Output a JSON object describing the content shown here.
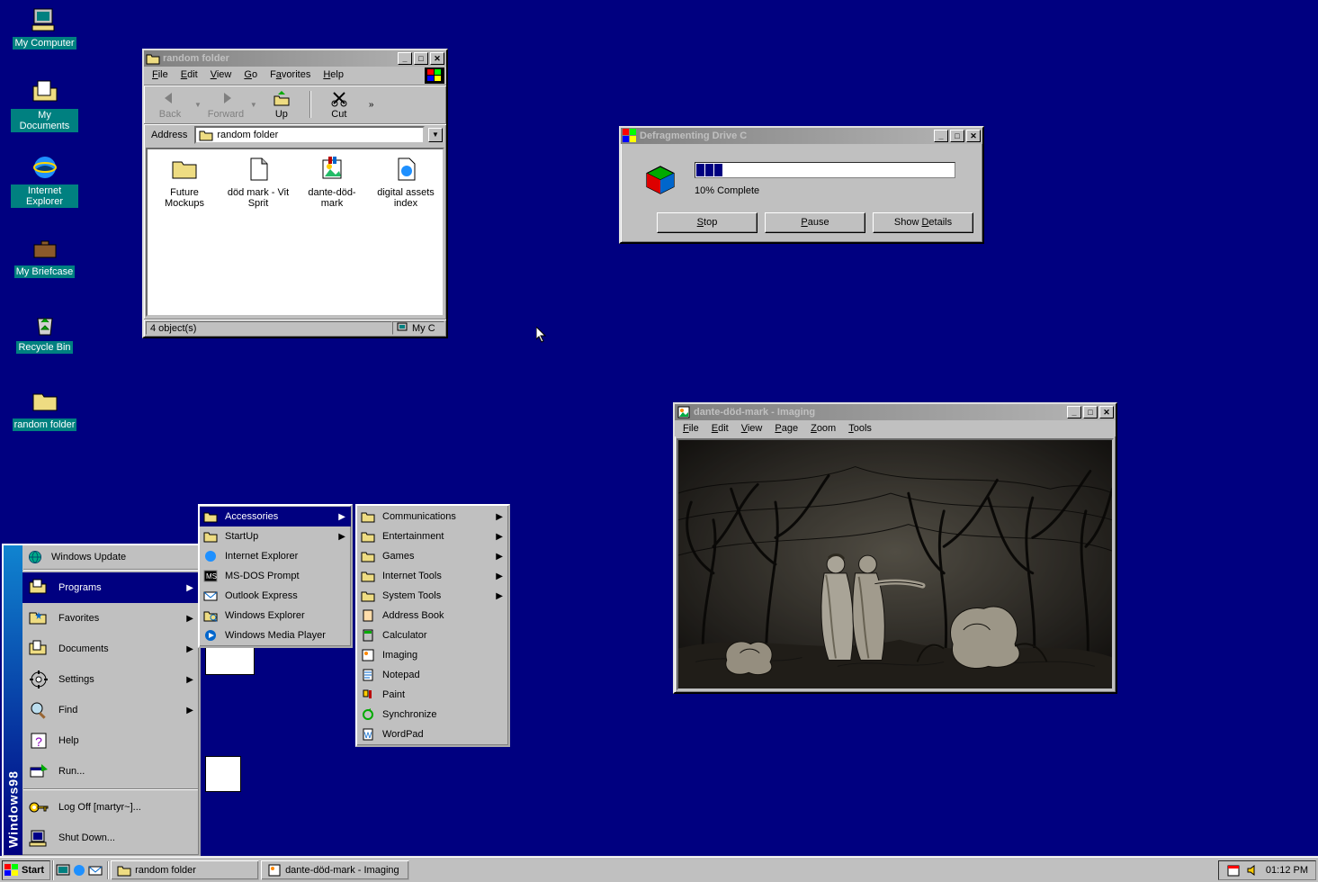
{
  "desktop": {
    "icons": [
      {
        "label": "My Computer"
      },
      {
        "label": "My Documents"
      },
      {
        "label": "Internet Explorer"
      },
      {
        "label": "My Briefcase"
      },
      {
        "label": "Recycle Bin"
      },
      {
        "label": "random folder"
      }
    ]
  },
  "explorer": {
    "title": "random folder",
    "menus": [
      "File",
      "Edit",
      "View",
      "Go",
      "Favorites",
      "Help"
    ],
    "toolbar": {
      "back": "Back",
      "forward": "Forward",
      "up": "Up",
      "cut": "Cut"
    },
    "address_label": "Address",
    "address_value": "random folder",
    "items": [
      {
        "label": "Future Mockups"
      },
      {
        "label": "död mark - Vit Sprit"
      },
      {
        "label": "dante-död-mark"
      },
      {
        "label": "digital assets index"
      }
    ],
    "status_left": "4 object(s)",
    "status_right": "My C"
  },
  "defrag": {
    "title": "Defragmenting Drive C",
    "progress_text": "10% Complete",
    "buttons": {
      "stop": "Stop",
      "pause": "Pause",
      "details": "Show Details"
    }
  },
  "imaging": {
    "title": "dante-död-mark - Imaging",
    "menus": [
      "File",
      "Edit",
      "View",
      "Page",
      "Zoom",
      "Tools"
    ]
  },
  "start_menu": {
    "banner": "Windows98",
    "items": [
      {
        "label": "Windows Update",
        "arrow": false
      },
      {
        "label": "Programs",
        "arrow": true,
        "highlighted": true
      },
      {
        "label": "Favorites",
        "arrow": true
      },
      {
        "label": "Documents",
        "arrow": true
      },
      {
        "label": "Settings",
        "arrow": true
      },
      {
        "label": "Find",
        "arrow": true
      },
      {
        "label": "Help",
        "arrow": false
      },
      {
        "label": "Run...",
        "arrow": false
      },
      {
        "label": "Log Off [martyr~]...",
        "arrow": false
      },
      {
        "label": "Shut Down...",
        "arrow": false
      }
    ],
    "programs": [
      {
        "label": "Accessories",
        "arrow": true,
        "highlighted": true
      },
      {
        "label": "StartUp",
        "arrow": true
      },
      {
        "label": "Internet Explorer",
        "arrow": false
      },
      {
        "label": "MS-DOS Prompt",
        "arrow": false
      },
      {
        "label": "Outlook Express",
        "arrow": false
      },
      {
        "label": "Windows Explorer",
        "arrow": false
      },
      {
        "label": "Windows Media Player",
        "arrow": false
      }
    ],
    "accessories": [
      {
        "label": "Communications",
        "arrow": true
      },
      {
        "label": "Entertainment",
        "arrow": true
      },
      {
        "label": "Games",
        "arrow": true
      },
      {
        "label": "Internet Tools",
        "arrow": true
      },
      {
        "label": "System Tools",
        "arrow": true
      },
      {
        "label": "Address Book",
        "arrow": false
      },
      {
        "label": "Calculator",
        "arrow": false
      },
      {
        "label": "Imaging",
        "arrow": false
      },
      {
        "label": "Notepad",
        "arrow": false
      },
      {
        "label": "Paint",
        "arrow": false
      },
      {
        "label": "Synchronize",
        "arrow": false
      },
      {
        "label": "WordPad",
        "arrow": false
      }
    ]
  },
  "taskbar": {
    "start": "Start",
    "tasks": [
      {
        "label": "random folder"
      },
      {
        "label": "dante-död-mark - Imaging"
      }
    ],
    "clock": "01:12 PM"
  }
}
